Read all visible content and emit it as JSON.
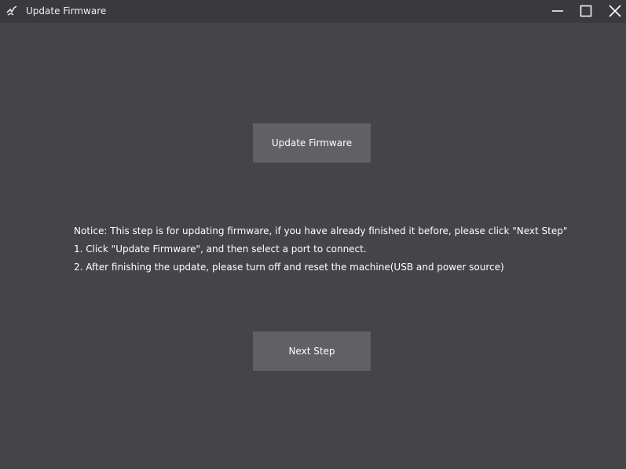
{
  "window": {
    "title": "Update Firmware",
    "icons": {
      "app": "app-logo-icon",
      "minimize": "minimize-icon",
      "maximize": "maximize-icon",
      "close": "close-icon"
    }
  },
  "main": {
    "update_button_label": "Update Firmware",
    "notice_lines": [
      "Notice: This step is for updating firmware, if you have already finished it before, please click \"Next Step\"",
      "1. Click \"Update Firmware\", and then select a port to connect.",
      "2. After finishing the update, please turn off and reset the machine(USB and power source)"
    ],
    "next_button_label": "Next Step"
  },
  "colors": {
    "background": "#454449",
    "titlebar": "#3a393e",
    "button": "#616064",
    "text": "#ffffff"
  }
}
